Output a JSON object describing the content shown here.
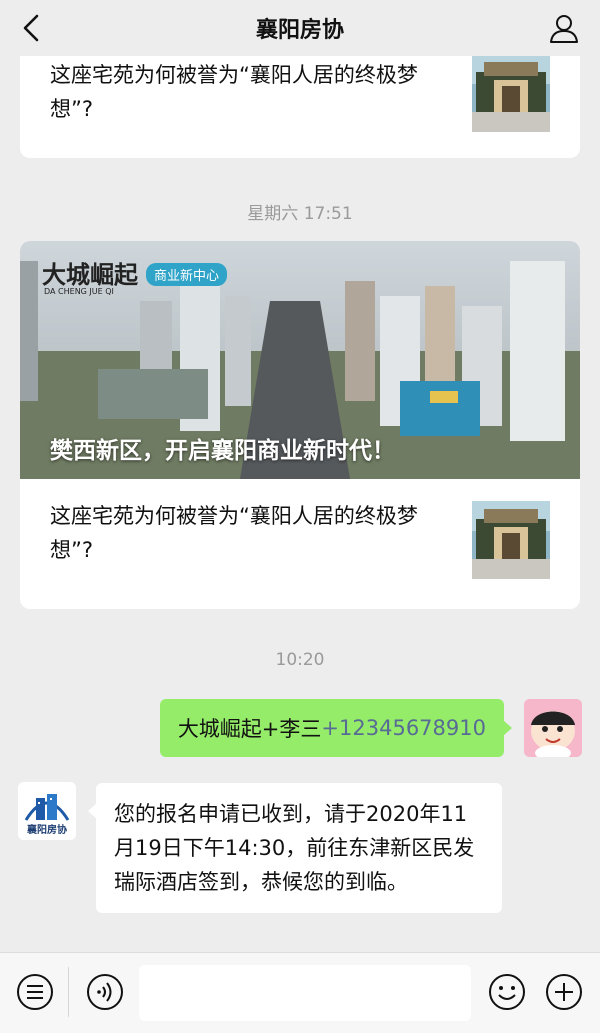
{
  "header": {
    "title": "襄阳房协"
  },
  "articles": {
    "top_card_title": "这座宅苑为何被誉为“襄阳人居的终极梦想”?",
    "hero_caption": "樊西新区，开启襄阳商业新时代！",
    "hero_logo_main": "大城崛起",
    "hero_logo_sub": "商业新中心",
    "hero_logo_pinyin": "DA CHENG JUE QI",
    "second_card_title": "这座宅苑为何被誉为“襄阳人居的终极梦想”?"
  },
  "timestamps": {
    "first": "星期六 17:51",
    "second": "10:20"
  },
  "messages": {
    "sent_text": "大城崛起+李三",
    "sent_phone": "+12345678910",
    "received_text": "您的报名申请已收到，请于2020年11月19日下午14:30，前往东津新区民发瑞际酒店签到，恭候您的到临。"
  },
  "org_avatar_label": "襄阳房协",
  "input": {
    "value": "",
    "placeholder": ""
  },
  "colors": {
    "sent_bubble": "#95ec69",
    "link": "#576b95",
    "background": "#ededed"
  },
  "icons": {
    "back": "chevron-left-icon",
    "profile": "person-icon",
    "menu": "menu-list-icon",
    "voice": "voice-icon",
    "emoji": "emoji-icon",
    "plus": "plus-icon"
  }
}
